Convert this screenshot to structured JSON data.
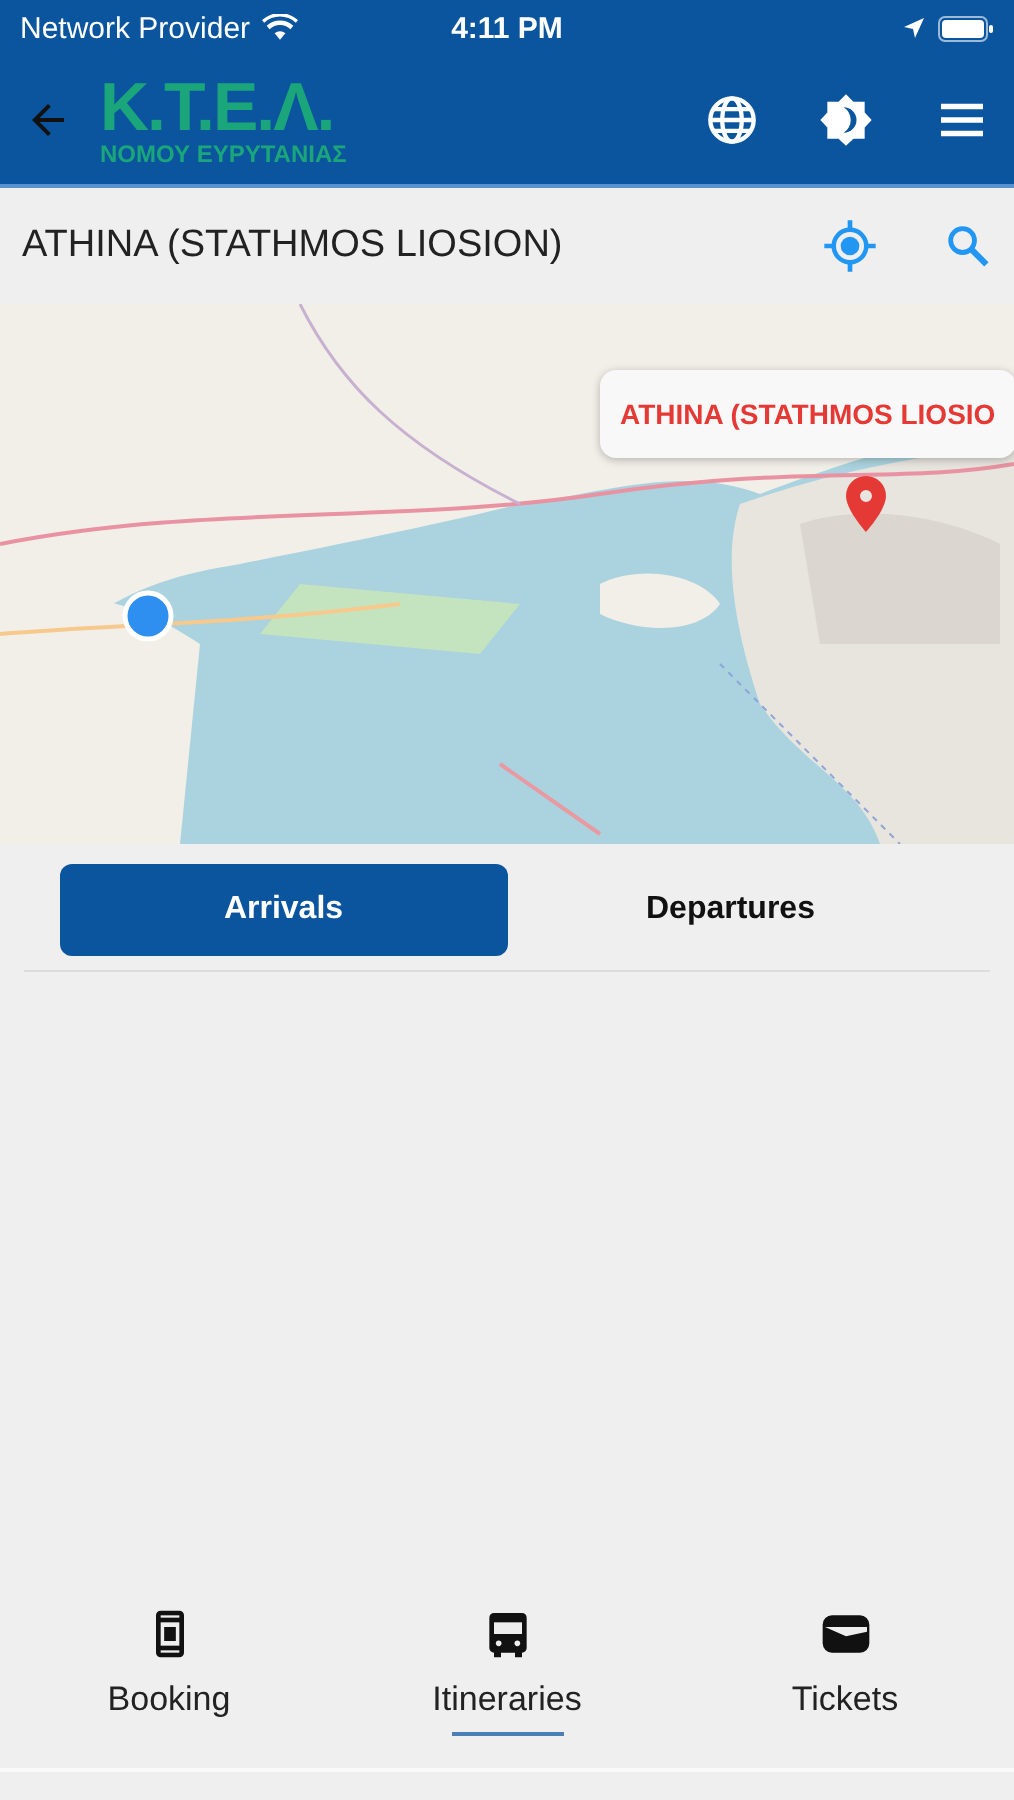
{
  "status_bar": {
    "carrier": "Network Provider",
    "time": "4:11 PM"
  },
  "header": {
    "logo_title": "K.T.E.Λ.",
    "logo_subtitle": "ΝΟΜΟΥ ΕΥΡΥΤΑΝΙΑΣ"
  },
  "station": {
    "name": "ATHINA (STATHMOS LIOSION)"
  },
  "map": {
    "callout": "ATHINA (STATHMOS LIOSIO"
  },
  "tabs": [
    {
      "label": "Arrivals",
      "selected": true
    },
    {
      "label": "Departures",
      "selected": false
    }
  ],
  "bottom_nav": [
    {
      "label": "Booking",
      "kind": "booking",
      "selected": false
    },
    {
      "label": "Itineraries",
      "kind": "bus",
      "selected": true
    },
    {
      "label": "Tickets",
      "kind": "ticket",
      "selected": false
    }
  ]
}
